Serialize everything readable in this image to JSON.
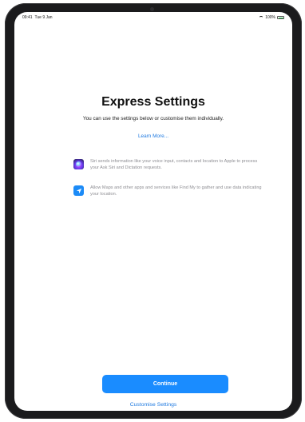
{
  "status_bar": {
    "time": "09:41",
    "date": "Tue 9 Jan",
    "battery_text": "100%",
    "battery_level": 1.0
  },
  "main": {
    "title": "Express Settings",
    "subtitle": "You can use the settings below or customise them individually.",
    "learn_more": "Learn More..."
  },
  "features": [
    {
      "icon": "siri-icon",
      "text": "Siri sends information like your voice input, contacts and location to Apple to process your Ask Siri and Dictation requests."
    },
    {
      "icon": "location-arrow-icon",
      "text": "Allow Maps and other apps and services like Find My to gather and use data indicating your location."
    }
  ],
  "actions": {
    "continue_label": "Continue",
    "customise_label": "Customise Settings"
  },
  "colors": {
    "accent": "#1a8cff",
    "link": "#1f7ae0",
    "battery_green": "#34c759"
  }
}
